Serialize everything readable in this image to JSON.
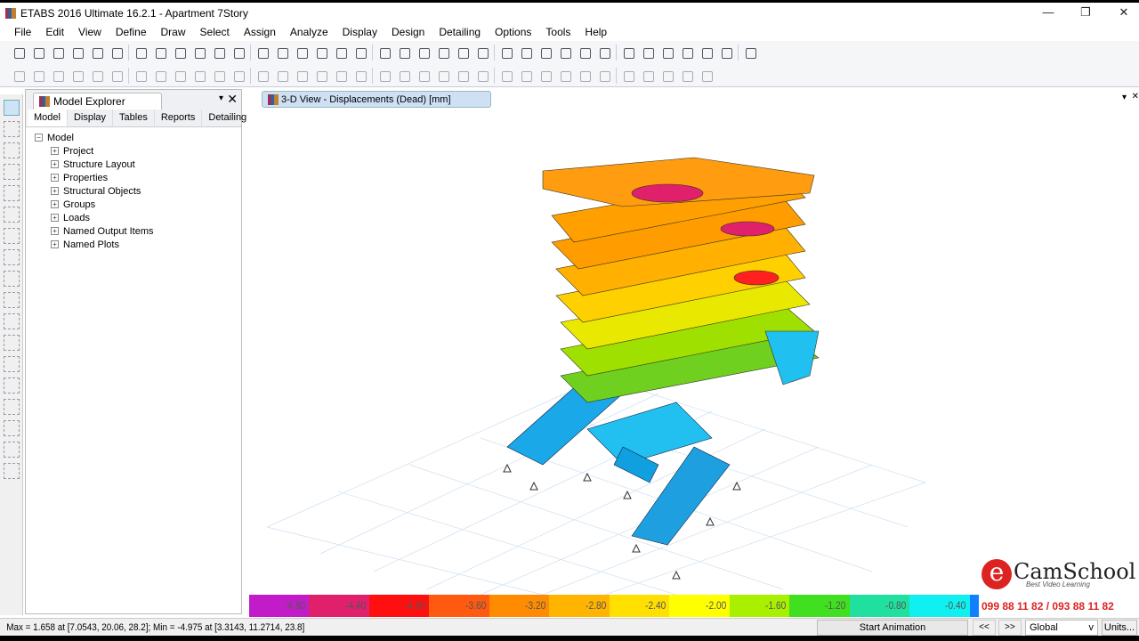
{
  "window": {
    "title": "ETABS 2016 Ultimate 16.2.1 - Apartment 7Story",
    "minimize": "—",
    "restore": "❐",
    "close": "✕"
  },
  "menu": [
    "File",
    "Edit",
    "View",
    "Define",
    "Draw",
    "Select",
    "Assign",
    "Analyze",
    "Display",
    "Design",
    "Detailing",
    "Options",
    "Tools",
    "Help"
  ],
  "toolbar1_icons": [
    "new-icon",
    "open-icon",
    "save-icon",
    "undo-icon",
    "redo-icon",
    "pencil-icon",
    "lock-icon",
    "run-icon",
    "zoom-window-icon",
    "zoom-restore-icon",
    "zoom-in-icon",
    "zoom-out-icon",
    "zoom-prev-icon",
    "pan-icon",
    "refresh-icon",
    "3d-view-icon",
    "plan-view-icon",
    "elevation-view-icon",
    "rotate-icon",
    "perspective-icon",
    "up-icon",
    "down-icon",
    "object-shrink-icon",
    "check-icon",
    "display-icon",
    "shadow-icon",
    "frame-icon",
    "deformed-icon",
    "forces-icon",
    "reactions-icon",
    "joint-icon",
    "text-icon",
    "table-icon",
    "filter-icon",
    "section-icon",
    "line-icon",
    "design-icon"
  ],
  "toolbar2_icons": [
    "draw-point-icon",
    "draw-joint-icon",
    "draw-column-icon",
    "draw-beam-icon",
    "draw-brace-icon",
    "draw-floor-icon",
    "draw-wall-icon",
    "draw-link-icon",
    "cut-icon",
    "copy-icon",
    "paste-icon",
    "delete-icon",
    "replicate-icon",
    "grid-icon",
    "select-all-icon",
    "snap-icon",
    "align-icon",
    "move-icon",
    "divide-icon",
    "join-icon",
    "merge-icon",
    "area-icon",
    "mesh-icon",
    "edit-icon",
    "load-icon",
    "moment-icon",
    "restraint-icon",
    "spring-icon",
    "insertion-icon",
    "rebar-icon",
    "slab-icon",
    "wall-stack-icon",
    "tendon-icon",
    "close-icon",
    "curve-icon"
  ],
  "left_tools": [
    "pointer-icon",
    "joint-icon",
    "line-icon",
    "frame-icon",
    "column-icon",
    "beam-icon",
    "brace-icon",
    "floor-icon",
    "wall-icon",
    "opening-icon",
    "link-icon",
    "grid-icon",
    "support-icon",
    "spring-icon",
    "all-icon",
    "ps-icon",
    "clr-icon",
    "select-icon"
  ],
  "explorer": {
    "title": "Model Explorer",
    "pin": "▾",
    "close": "✕",
    "tabs": [
      "Model",
      "Display",
      "Tables",
      "Reports",
      "Detailing"
    ],
    "root": "Model",
    "items": [
      "Project",
      "Structure Layout",
      "Properties",
      "Structural Objects",
      "Groups",
      "Loads",
      "Named Output Items",
      "Named Plots"
    ]
  },
  "view": {
    "tab_title": "3-D View  - Displacements (Dead)  [mm]",
    "dropdown": "▾",
    "close": "✕"
  },
  "legend": {
    "labels": [
      "-4.80",
      "-4.40",
      "-4.00",
      "-3.60",
      "-3.20",
      "-2.80",
      "-2.40",
      "-2.00",
      "-1.60",
      "-1.20",
      "-0.80",
      "-0.40"
    ],
    "colors": [
      "#c21cc8",
      "#e0206a",
      "#ff1010",
      "#ff5a10",
      "#ff8c00",
      "#ffb400",
      "#ffe000",
      "#ffff00",
      "#a8f000",
      "#40e020",
      "#20e0a0",
      "#10f0f0",
      "#1080ff"
    ]
  },
  "brand": {
    "logo": "eCamSchool",
    "tagline": "Best Video Learning",
    "phone": "099 88 11 82 / 093 88 11 82"
  },
  "status": {
    "text": "Max = 1.658 at [7.0543, 20.06, 28.2];  Min = -4.975 at [3.3143, 11.2714, 23.8]",
    "animation": "Start Animation",
    "prev": "<<",
    "next": ">>",
    "coord_system": "Global",
    "units": "Units..."
  }
}
